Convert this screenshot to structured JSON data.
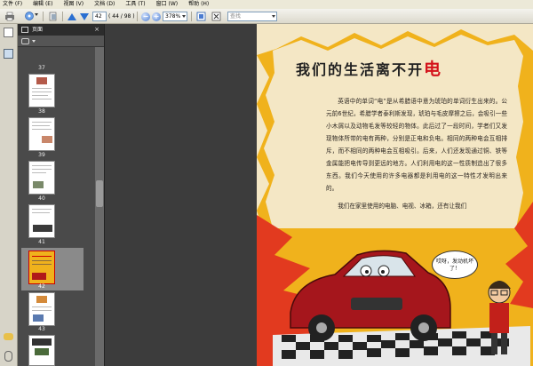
{
  "menu": {
    "items": [
      "文件 (F)",
      "编辑 (E)",
      "视图 (V)",
      "文档 (D)",
      "工具 (T)",
      "窗口 (W)",
      "帮助 (H)"
    ]
  },
  "toolbar": {
    "page_number": "42",
    "page_count": "( 44 / 98 )",
    "zoom": "378%",
    "search_placeholder": "查找"
  },
  "panel": {
    "title": "页面",
    "close": "×",
    "pages": [
      "37",
      "38",
      "39",
      "40",
      "41",
      "42",
      "43"
    ],
    "selected_page": "42"
  },
  "page": {
    "title_main": "我们的生活离不开",
    "title_accent": "电",
    "paragraph1": "英语中的单词“电”是从希腊语中意为琥珀的单词衍生出来的。公元前6世纪，希腊学者泰利斯发现，琥珀与毛皮摩擦之后，会吸引一些小木屑以及动物毛发等较轻的物体。此后过了一段时间，学者们又发现物体所带的电有两种，分别是正电和负电。相同的两种电会互相排斥，而不相同的两种电会互相吸引。后来，人们还发现通过铜、铁等金属能把电传导到更远的地方。人们利用电的这一性质制造出了很多东西。我们今天使用的许多电器都是利用电的这一特性才发明出来的。",
    "paragraph2": "我们在家里使用的电脑、电视、冰箱，还有让我们",
    "bubble": "哎呀，发动机坏了！"
  },
  "colors": {
    "accent": "#d4131b",
    "flame": "#f0b21c"
  }
}
